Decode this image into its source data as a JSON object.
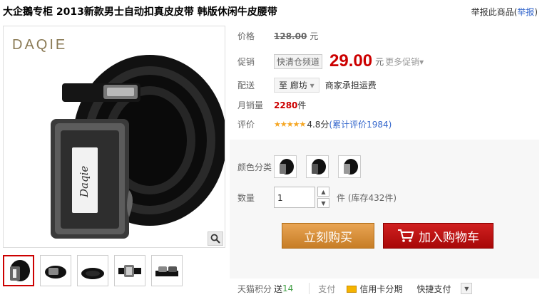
{
  "product": {
    "title": "大企鵝专柜 2013新款男士自动扣真皮皮带 韩版休闲牛皮腰带",
    "report_text": "举报此商品(",
    "report_link": "举报",
    "report_close": ")"
  },
  "gallery": {
    "brand_logo": "DAQIE",
    "buckle_text": "Daqie",
    "zoom_icon": "magnifier-icon",
    "thumbs": [
      "thumb-1",
      "thumb-2",
      "thumb-3",
      "thumb-4",
      "thumb-5"
    ]
  },
  "price": {
    "label": "价格",
    "original": "128.00",
    "unit": "元"
  },
  "promo": {
    "label": "促销",
    "tag": "快清仓频道",
    "price": "29.00",
    "unit": "元",
    "more": "更多促销"
  },
  "delivery": {
    "label": "配送",
    "region": "至 廊坊",
    "note": "商家承担运费"
  },
  "sales": {
    "label": "月销量",
    "count": "2280",
    "unit": "件"
  },
  "rating": {
    "label": "评价",
    "stars": "★★★★★",
    "score": "4.8分",
    "reviews": "(累计评价1984)"
  },
  "sku": {
    "color_label": "颜色分类",
    "qty_label": "数量",
    "qty_value": "1",
    "stock": "件 (库存432件)"
  },
  "actions": {
    "buy": "立刻购买",
    "cart": "加入购物车"
  },
  "footer": {
    "points_label": "天猫积分",
    "points_prefix": "送",
    "points_value": "14",
    "pay_label": "支付",
    "installment": "信用卡分期",
    "quick_pay": "快捷支付"
  },
  "colors": {
    "price_red": "#cc0000",
    "buy_orange": "#d88b2e",
    "cart_red": "#b80e0e",
    "link_blue": "#3366cc"
  }
}
